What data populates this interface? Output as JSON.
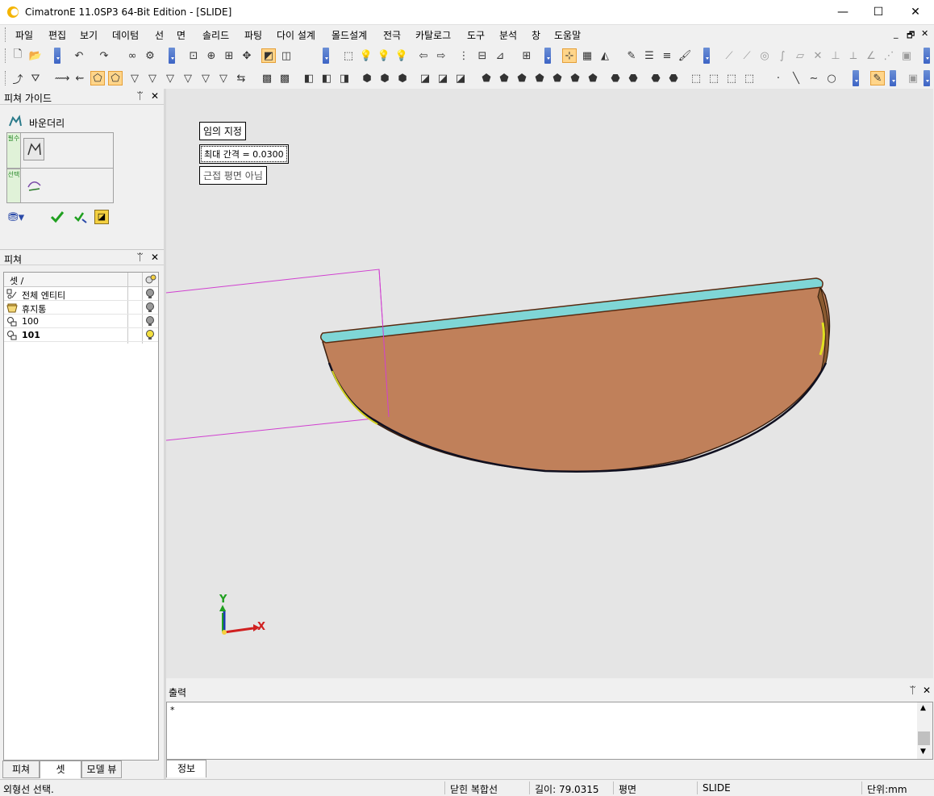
{
  "window": {
    "title": "CimatronE 11.0SP3 64-Bit Edition - [SLIDE]",
    "minimize_glyph": "—",
    "maximize_glyph": "☐",
    "close_glyph": "✕"
  },
  "menu": {
    "items": [
      "파일",
      "편집",
      "보기",
      "데이텀",
      "선",
      "면",
      "솔리드",
      "파팅",
      "다이 설계",
      "몰드설계",
      "전극",
      "카탈로그",
      "도구",
      "분석",
      "창",
      "도움말"
    ],
    "mdi_minimize": "_",
    "mdi_restore": "🗗",
    "mdi_close": "✕"
  },
  "feature_guide": {
    "title": "피쳐 가이드",
    "pin": "ᛠ",
    "close": "✕",
    "step_label": "바운더리",
    "strip1": "필수",
    "strip2": "선택"
  },
  "features_panel": {
    "title": "피쳐",
    "pin": "ᛠ",
    "close": "✕",
    "column_header": "셋 /",
    "rows": [
      {
        "name": "전체 엔티티",
        "bold": false,
        "bulb": "gray"
      },
      {
        "name": "휴지통",
        "bold": false,
        "bulb": "gray"
      },
      {
        "name": "100",
        "bold": false,
        "bulb": "gray"
      },
      {
        "name": "101",
        "bold": true,
        "bulb": "yellow"
      }
    ]
  },
  "bottom_tabs": {
    "left": [
      "피쳐",
      "셋",
      "모델 뷰"
    ],
    "active_left": "셋",
    "right": [
      "정보"
    ]
  },
  "viewport": {
    "label_arbitrary": "임의 지정",
    "label_max_gap": "최대 간격 =  0.0300",
    "label_not_planar": "근접 평면 아님",
    "axis_x": "X",
    "axis_y": "Y"
  },
  "output": {
    "title": "출력",
    "pin": "ᛠ",
    "close": "✕",
    "content": "*"
  },
  "status": {
    "prompt": "외형선 선택.",
    "curve_type": "닫힌 복합선",
    "length": "길이: 79.0315",
    "plane": "평면",
    "file": "SLIDE",
    "units": "단위:mm"
  },
  "colors": {
    "viewport_bg": "#e5e5e5",
    "solid_face": "#c0805a",
    "top_face": "#7fd6d6",
    "plane_outline": "#d040d0",
    "active_tool": "#ffd58a"
  }
}
